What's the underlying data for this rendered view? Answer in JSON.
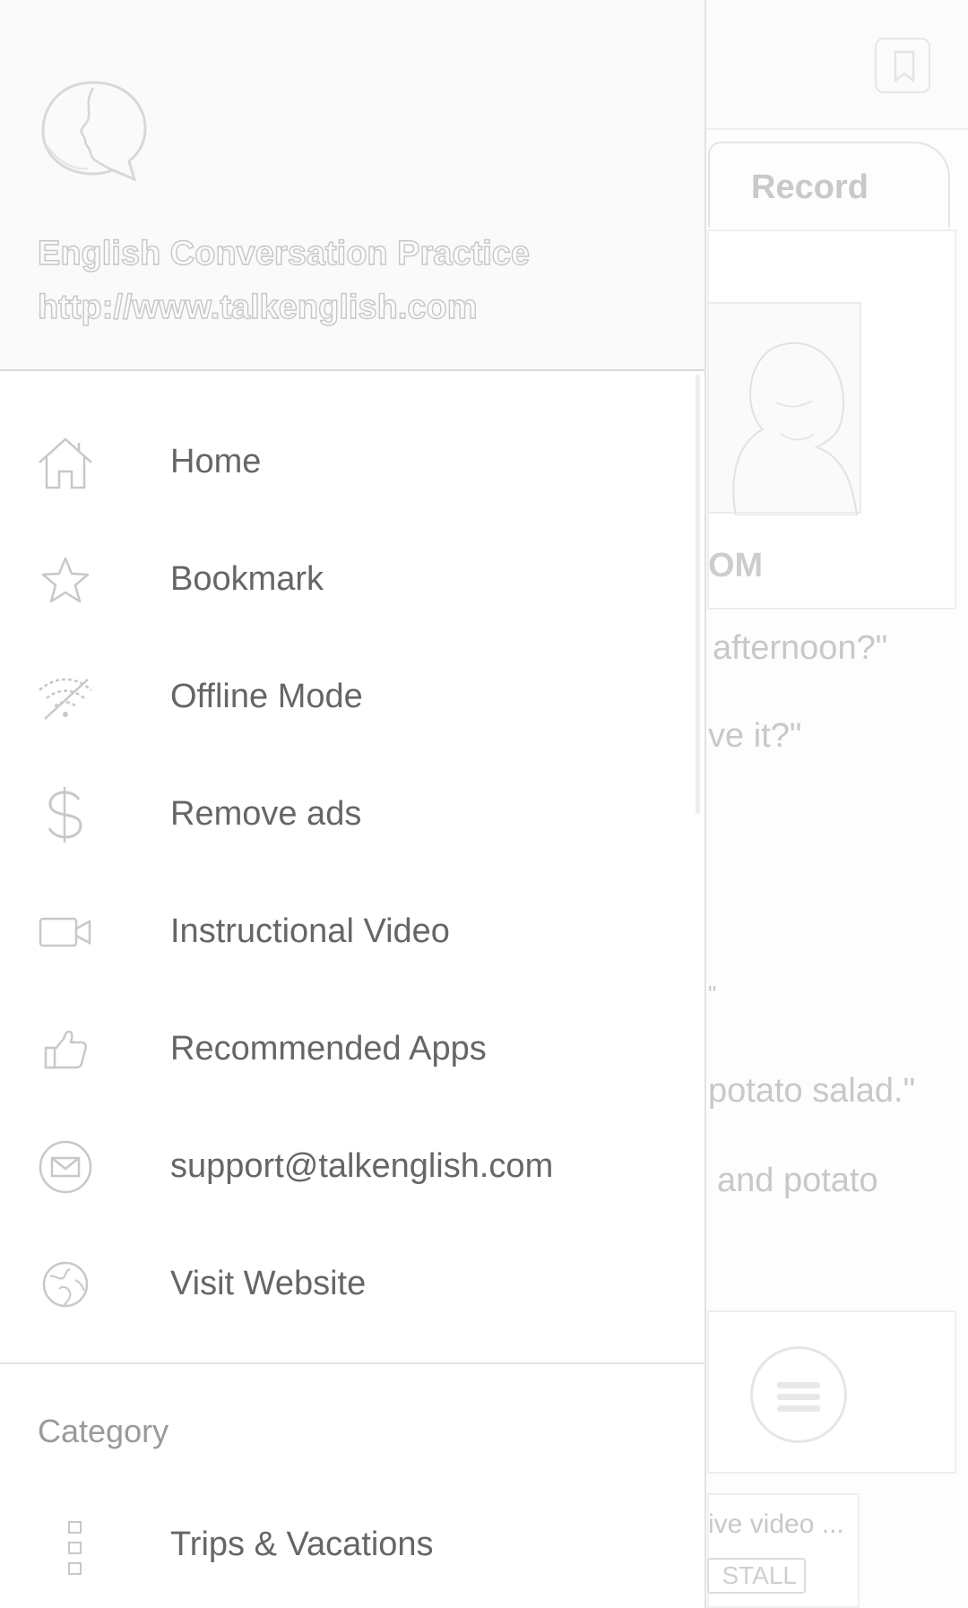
{
  "background": {
    "tab_record": "Record",
    "presenter_partial": "OM",
    "lines": [
      "afternoon?\"",
      "ve it?\"",
      "\"",
      "potato salad.\"",
      "and potato"
    ],
    "ad_text": "ive video ...",
    "ad_button": "STALL"
  },
  "drawer": {
    "app_title": "English Conversation Practice",
    "app_url": "http://www.talkenglish.com",
    "menu": [
      {
        "label": "Home",
        "icon": "home-icon"
      },
      {
        "label": "Bookmark",
        "icon": "star-icon"
      },
      {
        "label": "Offline Mode",
        "icon": "wifi-off-icon"
      },
      {
        "label": "Remove ads",
        "icon": "dollar-icon"
      },
      {
        "label": "Instructional Video",
        "icon": "video-camera-icon"
      },
      {
        "label": "Recommended Apps",
        "icon": "thumbs-up-icon"
      },
      {
        "label": "support@talkenglish.com",
        "icon": "email-icon"
      },
      {
        "label": "Visit Website",
        "icon": "globe-icon"
      }
    ],
    "category_heading": "Category",
    "categories": [
      {
        "label": "Trips & Vacations",
        "icon": "list-icon"
      }
    ]
  }
}
